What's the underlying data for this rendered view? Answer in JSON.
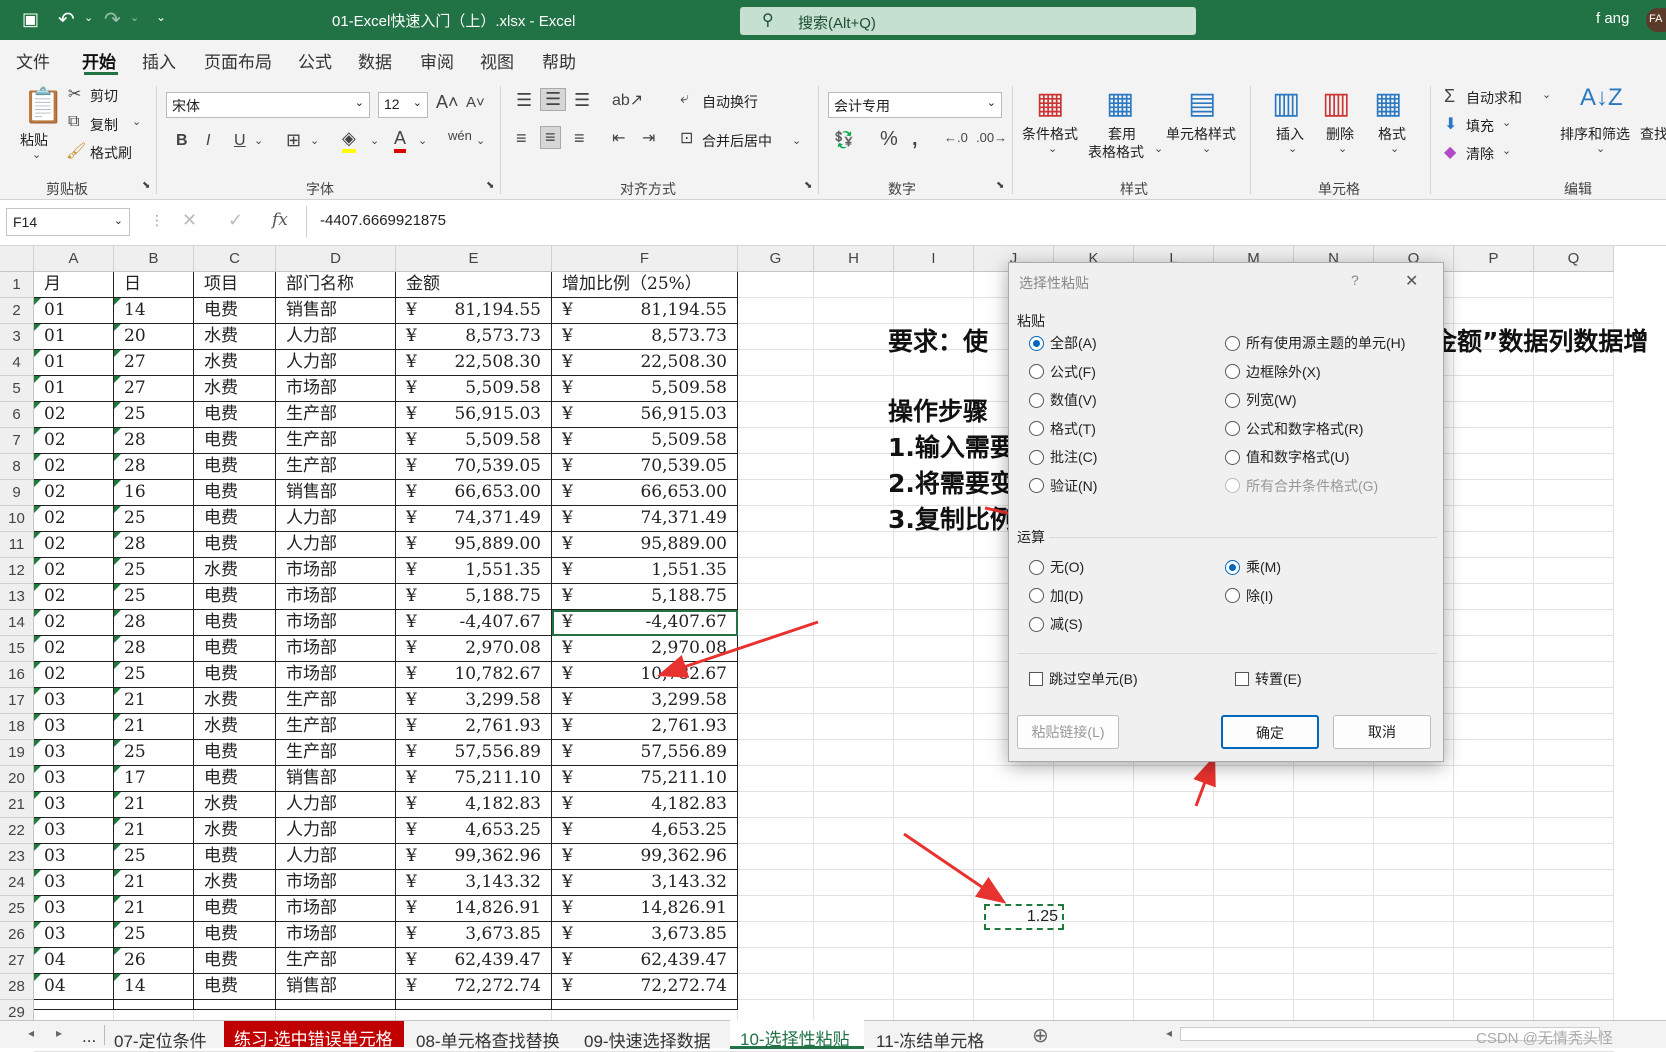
{
  "titlebar": {
    "title": "01-Excel快速入门（上）.xlsx  -  Excel",
    "search": "搜索(Alt+Q)",
    "user": "f ang",
    "avatar": "FA"
  },
  "tabs": [
    "文件",
    "开始",
    "插入",
    "页面布局",
    "公式",
    "数据",
    "审阅",
    "视图",
    "帮助"
  ],
  "ribbon": {
    "clipboard": {
      "paste": "粘贴",
      "cut": "剪切",
      "copy": "复制",
      "painter": "格式刷",
      "group": "剪贴板"
    },
    "font": {
      "name": "宋体",
      "size": "12",
      "bold": "B",
      "italic": "I",
      "underline": "U",
      "group": "字体"
    },
    "align": {
      "wrap": "自动换行",
      "merge": "合并后居中",
      "group": "对齐方式"
    },
    "number": {
      "format": "会计专用",
      "group": "数字"
    },
    "styles": {
      "cond": "条件格式",
      "table1": "套用",
      "table2": "表格格式",
      "cell": "单元格样式",
      "group": "样式"
    },
    "cells": {
      "insert": "插入",
      "delete": "删除",
      "format": "格式",
      "group": "单元格"
    },
    "edit": {
      "autosum": "自动求和",
      "fill": "填充",
      "clear": "清除",
      "sort": "排序和筛选",
      "find": "查找",
      "group": "编辑"
    }
  },
  "formula_bar": {
    "name_box": "F14",
    "fx": "fx",
    "value": "-4407.6669921875"
  },
  "columns": [
    "A",
    "B",
    "C",
    "D",
    "E",
    "F",
    "G",
    "H",
    "I",
    "J",
    "K",
    "L",
    "M",
    "N",
    "O",
    "P",
    "Q"
  ],
  "headers": [
    "月",
    "日",
    "项目",
    "部门名称",
    "金额",
    "增加比例（25%）"
  ],
  "rows": [
    [
      "01",
      "14",
      "电费",
      "销售部",
      "81,194.55",
      "81,194.55"
    ],
    [
      "01",
      "20",
      "水费",
      "人力部",
      "8,573.73",
      "8,573.73"
    ],
    [
      "01",
      "27",
      "水费",
      "人力部",
      "22,508.30",
      "22,508.30"
    ],
    [
      "01",
      "27",
      "水费",
      "市场部",
      "5,509.58",
      "5,509.58"
    ],
    [
      "02",
      "25",
      "电费",
      "生产部",
      "56,915.03",
      "56,915.03"
    ],
    [
      "02",
      "28",
      "电费",
      "生产部",
      "5,509.58",
      "5,509.58"
    ],
    [
      "02",
      "28",
      "电费",
      "生产部",
      "70,539.05",
      "70,539.05"
    ],
    [
      "02",
      "16",
      "电费",
      "销售部",
      "66,653.00",
      "66,653.00"
    ],
    [
      "02",
      "25",
      "电费",
      "人力部",
      "74,371.49",
      "74,371.49"
    ],
    [
      "02",
      "28",
      "电费",
      "人力部",
      "95,889.00",
      "95,889.00"
    ],
    [
      "02",
      "25",
      "水费",
      "市场部",
      "1,551.35",
      "1,551.35"
    ],
    [
      "02",
      "25",
      "电费",
      "市场部",
      "5,188.75",
      "5,188.75"
    ],
    [
      "02",
      "28",
      "电费",
      "市场部",
      "-4,407.67",
      "-4,407.67"
    ],
    [
      "02",
      "28",
      "电费",
      "市场部",
      "2,970.08",
      "2,970.08"
    ],
    [
      "02",
      "25",
      "电费",
      "市场部",
      "10,782.67",
      "10,782.67"
    ],
    [
      "03",
      "21",
      "水费",
      "生产部",
      "3,299.58",
      "3,299.58"
    ],
    [
      "03",
      "21",
      "水费",
      "生产部",
      "2,761.93",
      "2,761.93"
    ],
    [
      "03",
      "25",
      "电费",
      "生产部",
      "57,556.89",
      "57,556.89"
    ],
    [
      "03",
      "17",
      "电费",
      "销售部",
      "75,211.10",
      "75,211.10"
    ],
    [
      "03",
      "21",
      "水费",
      "人力部",
      "4,182.83",
      "4,182.83"
    ],
    [
      "03",
      "21",
      "水费",
      "人力部",
      "4,653.25",
      "4,653.25"
    ],
    [
      "03",
      "25",
      "电费",
      "人力部",
      "99,362.96",
      "99,362.96"
    ],
    [
      "03",
      "21",
      "水费",
      "市场部",
      "3,143.32",
      "3,143.32"
    ],
    [
      "03",
      "21",
      "电费",
      "市场部",
      "14,826.91",
      "14,826.91"
    ],
    [
      "03",
      "25",
      "电费",
      "市场部",
      "3,673.85",
      "3,673.85"
    ],
    [
      "04",
      "26",
      "电费",
      "生产部",
      "62,439.47",
      "62,439.47"
    ],
    [
      "04",
      "14",
      "电费",
      "销售部",
      "72,272.74",
      "72,272.74"
    ]
  ],
  "currency": "¥",
  "notes": {
    "line1a": "要求：使",
    "line1b": "金额”数据列数据增",
    "line2": "操作步骤",
    "line3": "1.输入需要",
    "line4": "2.将需要变",
    "line5": "3.复制比例"
  },
  "multiplier": "1.25",
  "dialog": {
    "title": "选择性粘贴",
    "help": "?",
    "close": "✕",
    "paste_label": "粘贴",
    "paste_left": [
      "全部(A)",
      "公式(F)",
      "数值(V)",
      "格式(T)",
      "批注(C)",
      "验证(N)"
    ],
    "paste_right": [
      "所有使用源主题的单元(H)",
      "边框除外(X)",
      "列宽(W)",
      "公式和数字格式(R)",
      "值和数字格式(U)",
      "所有合并条件格式(G)"
    ],
    "op_label": "运算",
    "op_left": [
      "无(O)",
      "加(D)",
      "减(S)"
    ],
    "op_right": [
      "乘(M)",
      "除(I)"
    ],
    "skip_blanks": "跳过空单元(B)",
    "transpose": "转置(E)",
    "paste_link": "粘贴链接(L)",
    "ok": "确定",
    "cancel": "取消"
  },
  "sheets": [
    "...",
    "07-定位条件",
    "练习-选中错误单元格",
    "08-单元格查找替换",
    "09-快速选择数据",
    "10-选择性粘贴",
    "11-冻结单元格"
  ],
  "watermark": "CSDN @无情秃头怪"
}
